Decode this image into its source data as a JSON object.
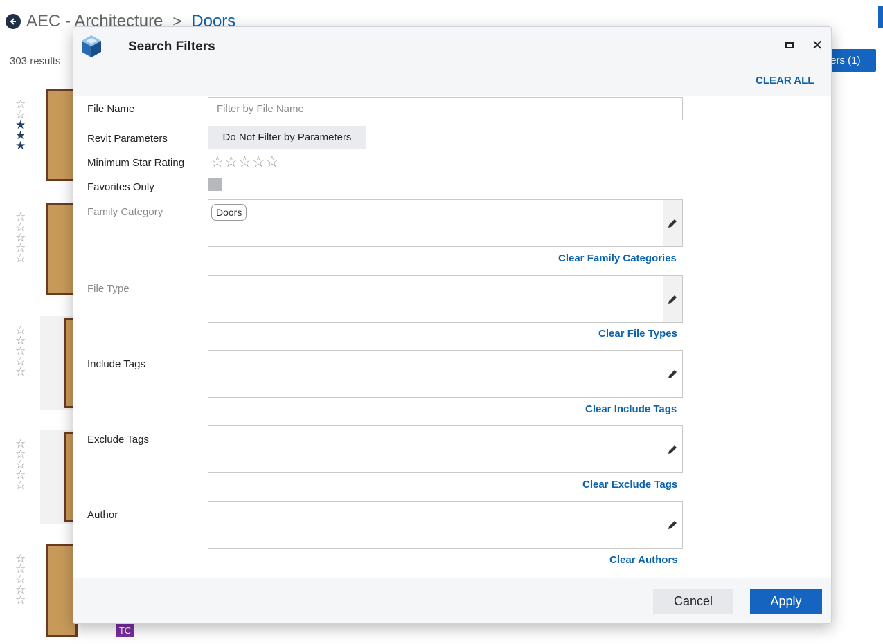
{
  "background": {
    "breadcrumb_parent": "AEC - Architecture",
    "breadcrumb_separator": ">",
    "breadcrumb_current": "Doors",
    "results_count": "303 results",
    "filters_button_label": "ters (1)",
    "results": [
      {
        "rating": 3
      },
      {
        "rating": 0
      },
      {
        "rating": 0
      },
      {
        "rating": 0
      },
      {
        "rating": 0
      }
    ],
    "tc_badge": "TC"
  },
  "modal": {
    "title": "Search Filters",
    "clear_all": "CLEAR ALL",
    "labels": {
      "file_name": "File Name",
      "revit_parameters": "Revit Parameters",
      "min_star_rating": "Minimum Star Rating",
      "favorites_only": "Favorites Only",
      "family_category": "Family Category",
      "file_type": "File Type",
      "include_tags": "Include Tags",
      "exclude_tags": "Exclude Tags",
      "author": "Author"
    },
    "file_name_placeholder": "Filter by File Name",
    "file_name_value": "",
    "revit_parameters_button": "Do Not Filter by Parameters",
    "min_star_rating_value": 0,
    "favorites_only_checked": false,
    "family_category_chips": [
      "Doors"
    ],
    "clear_links": {
      "family_categories": "Clear Family Categories",
      "file_types": "Clear File Types",
      "include_tags": "Clear Include Tags",
      "exclude_tags": "Clear Exclude Tags",
      "authors": "Clear Authors"
    },
    "cancel_label": "Cancel",
    "apply_label": "Apply"
  },
  "colors": {
    "accent": "#1565c0",
    "link": "#0b63ad",
    "rating_filled": "#1f3f66",
    "tc_badge": "#7b2fa0"
  }
}
